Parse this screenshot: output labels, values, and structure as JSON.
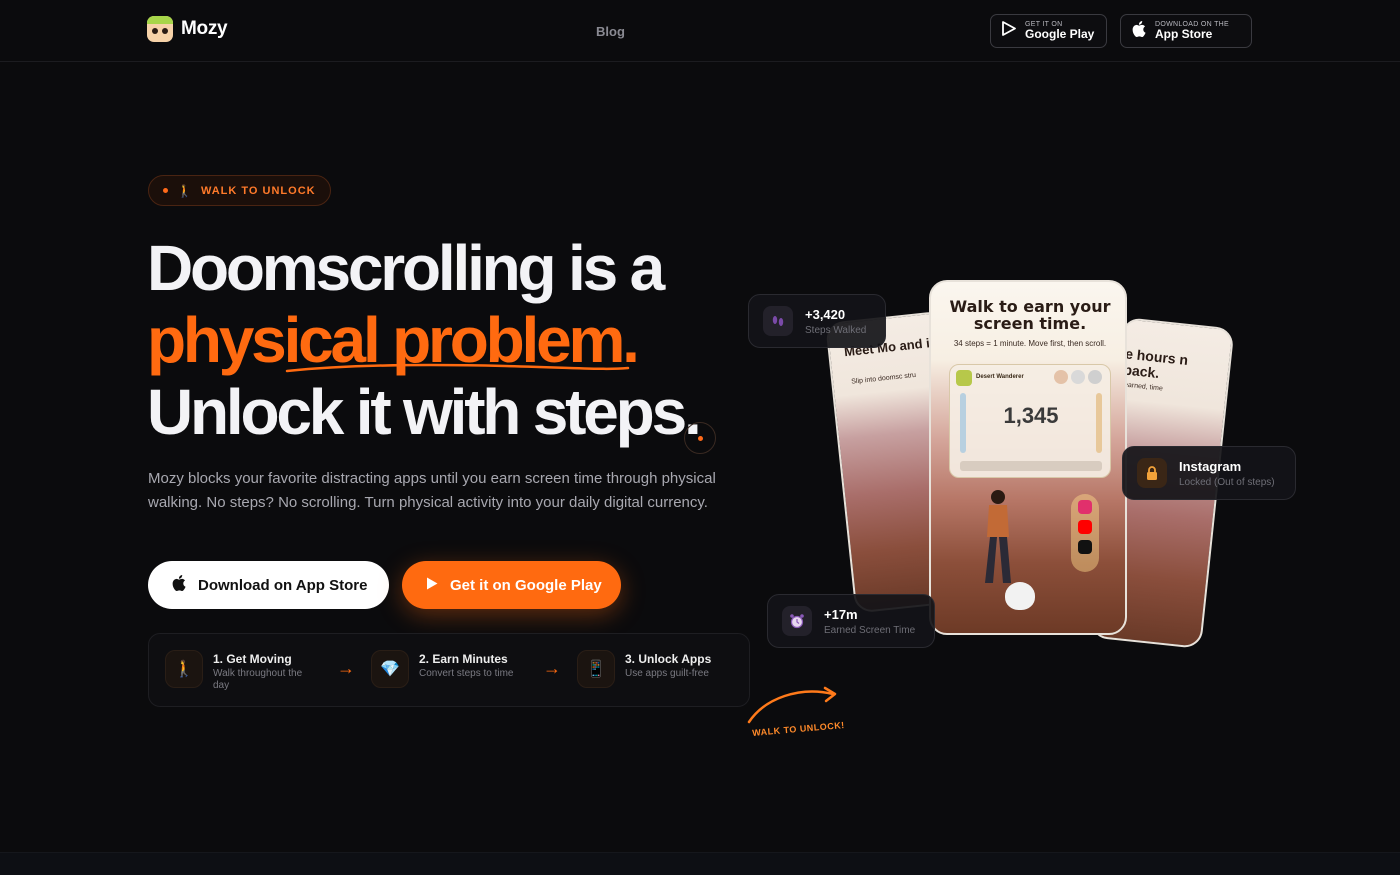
{
  "brand": {
    "name": "Mozy"
  },
  "nav": {
    "blog": "Blog",
    "google_play": {
      "small": "GET IT ON",
      "large": "Google Play"
    },
    "app_store": {
      "small": "DOWNLOAD ON THE",
      "large": "App Store"
    }
  },
  "hero": {
    "badge": "WALK TO UNLOCK",
    "title_line1": "Doomscrolling is a",
    "title_line2": "physical problem.",
    "title_line3": "Unlock it with steps.",
    "description": "Mozy blocks your favorite distracting apps until you earn screen time through physical walking. No steps? No scrolling. Turn physical activity into your daily digital currency.",
    "cta_app_store": "Download on App Store",
    "cta_google_play": "Get it on Google Play"
  },
  "steps": [
    {
      "title": "1. Get Moving",
      "subtitle": "Walk throughout the day"
    },
    {
      "title": "2. Earn Minutes",
      "subtitle": "Convert steps to time"
    },
    {
      "title": "3. Unlock Apps",
      "subtitle": "Use apps guilt-free"
    }
  ],
  "walk_label": "WALK TO UNLOCK!",
  "phone": {
    "title": "Walk to earn your screen time.",
    "subtitle": "34 steps = 1 minute. Move first, then scroll.",
    "card_name": "Desert Wanderer",
    "steps_value": "1,345"
  },
  "back_left": {
    "title": "Meet Mo and it t",
    "sub": "Slip into doomsc stru"
  },
  "back_right": {
    "title": "e hours n back.",
    "sub": "earned, time"
  },
  "floaters": {
    "steps": {
      "title": "+3,420",
      "subtitle": "Steps Walked"
    },
    "instagram": {
      "title": "Instagram",
      "subtitle": "Locked (Out of steps)"
    },
    "earned": {
      "title": "+17m",
      "subtitle": "Earned Screen Time"
    }
  },
  "colors": {
    "accent": "#ff6a10",
    "background": "#0b0b0d"
  }
}
